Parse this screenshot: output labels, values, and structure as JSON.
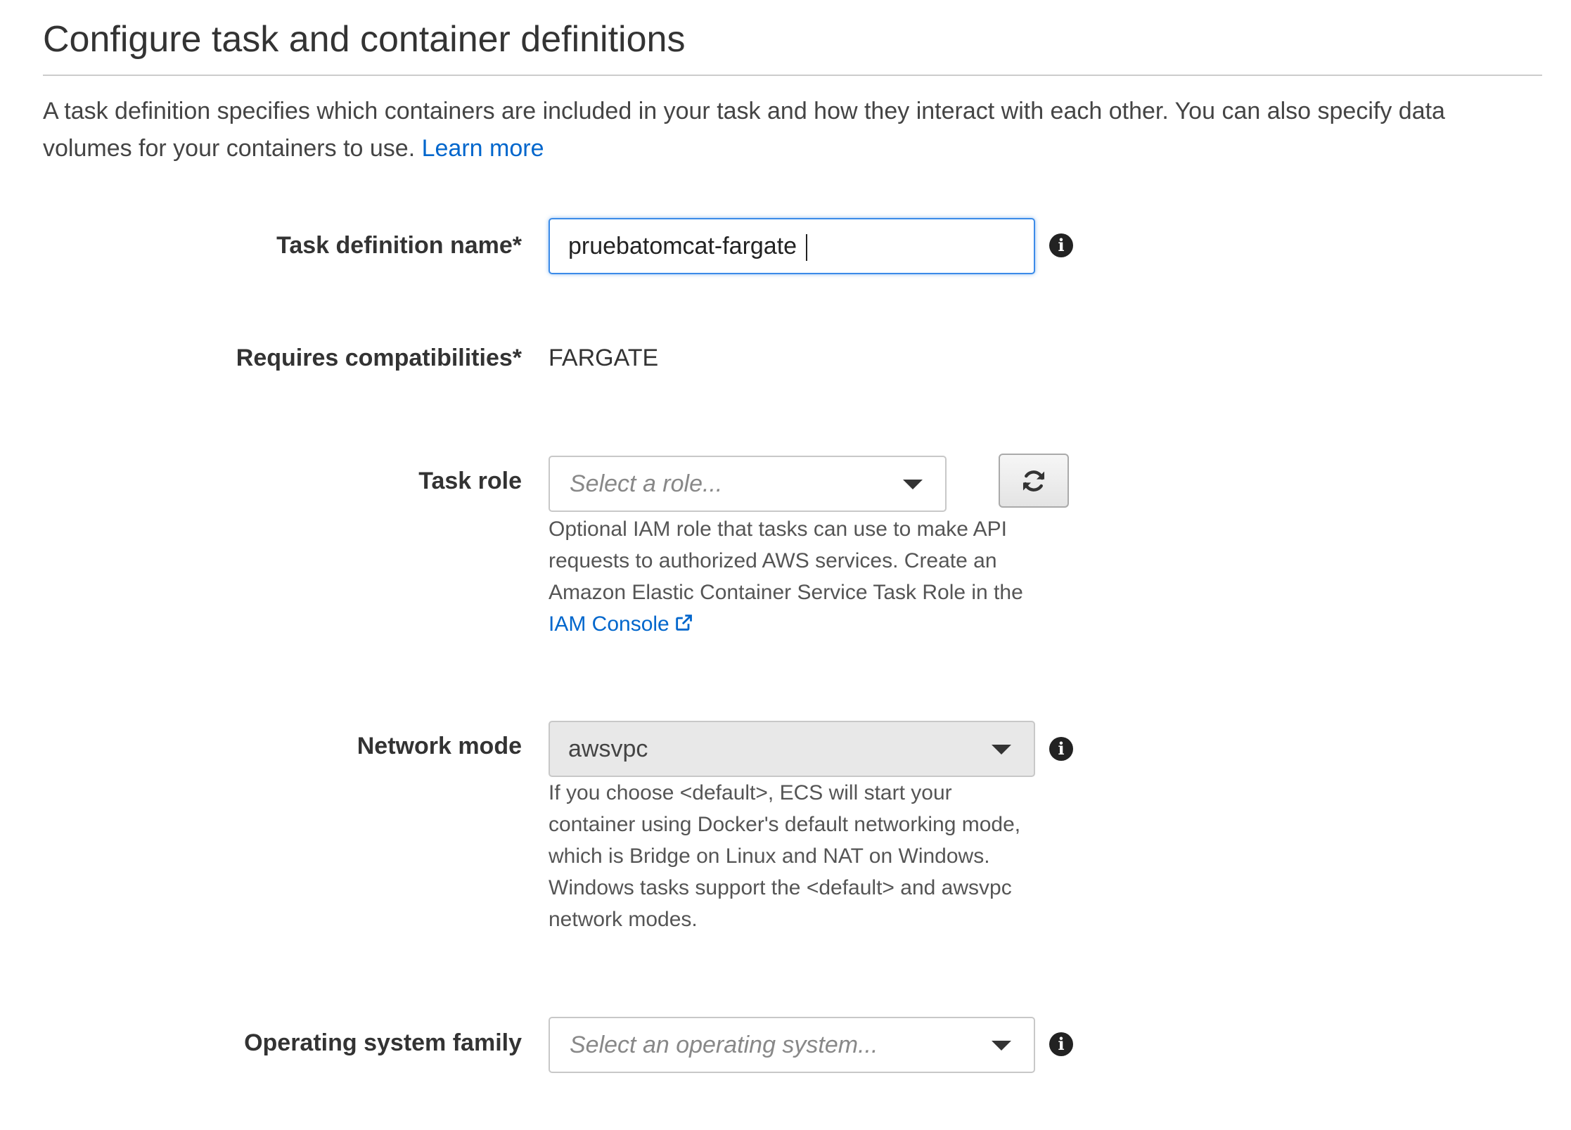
{
  "page": {
    "title": "Configure task and container definitions",
    "intro": "A task definition specifies which containers are included in your task and how they interact with each other. You can also specify data volumes for your containers to use.",
    "learn_more": "Learn more"
  },
  "fields": {
    "task_definition_name": {
      "label": "Task definition name*",
      "value": "pruebatomcat-fargate",
      "info_icon": "info-icon"
    },
    "requires_compatibilities": {
      "label": "Requires compatibilities*",
      "value": "FARGATE"
    },
    "task_role": {
      "label": "Task role",
      "placeholder": "Select a role...",
      "refresh_icon": "refresh-icon",
      "help": "Optional IAM role that tasks can use to make API requests to authorized AWS services. Create an Amazon Elastic Container Service Task Role in the",
      "help_link": "IAM Console",
      "help_link_icon": "external-link-icon"
    },
    "network_mode": {
      "label": "Network mode",
      "value": "awsvpc",
      "help": "If you choose <default>, ECS will start your container using Docker's default networking mode, which is Bridge on Linux and NAT on Windows. Windows tasks support the <default> and awsvpc network modes.",
      "info_icon": "info-icon"
    },
    "operating_system_family": {
      "label": "Operating system family",
      "placeholder": "Select an operating system...",
      "info_icon": "info-icon"
    }
  },
  "colors": {
    "link": "#0066cc",
    "focus_border": "#3b8be8",
    "disabled_select": "#e8e8e8"
  }
}
